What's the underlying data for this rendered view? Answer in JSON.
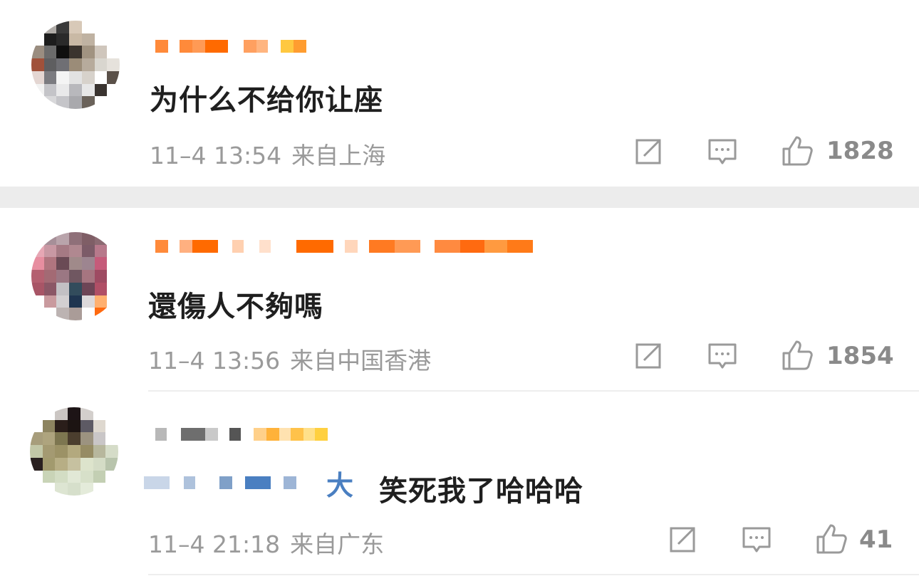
{
  "comments": [
    {
      "text": "为什么不给你让座",
      "time": "11–4 13:54",
      "location": "来自上海",
      "likes": "1828"
    },
    {
      "text": "還傷人不夠嗎",
      "time": "11–4 13:56",
      "location": "来自中国香港",
      "likes": "1854"
    },
    {
      "text": "笑死我了哈哈哈",
      "mention_tail": "大",
      "time": "11–4 21:18",
      "location": "来自广东",
      "likes": "41"
    }
  ],
  "icons": {
    "share": "share-edit-icon",
    "comment": "comment-bubble-icon",
    "like": "thumbs-up-icon"
  },
  "colors": {
    "username_orange": "#ff7a1a",
    "mention_blue": "#4a7fc1",
    "meta_gray": "#9a9a9a"
  }
}
